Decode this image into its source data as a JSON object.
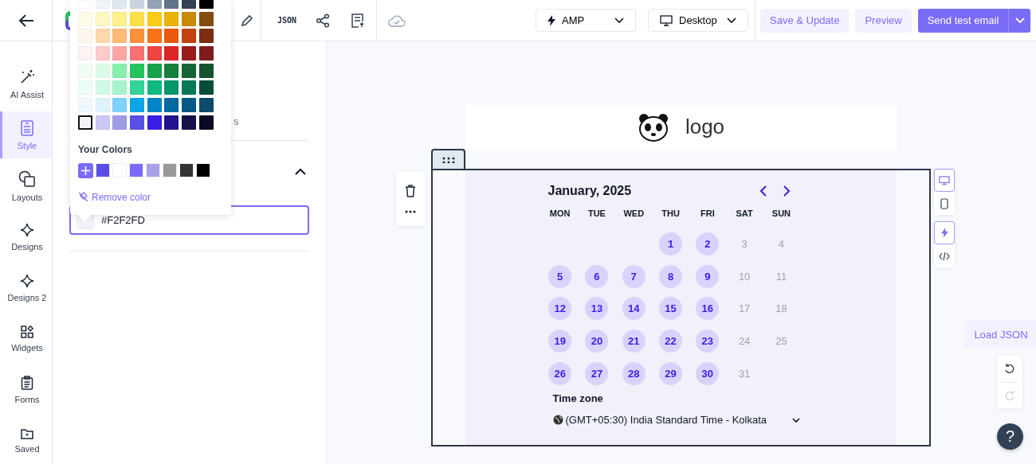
{
  "toolbar": {
    "json_label": "JSON",
    "amp_dropdown": "AMP",
    "device_dropdown": "Desktop",
    "save_button": "Save & Update",
    "preview_button": "Preview",
    "send_button": "Send test email"
  },
  "rail": [
    {
      "kind": "wand",
      "label": "AI Assist",
      "selected": false
    },
    {
      "kind": "style",
      "label": "Style",
      "selected": true
    },
    {
      "kind": "layouts",
      "label": "Layouts",
      "selected": false
    },
    {
      "kind": "sparkle",
      "label": "Designs",
      "selected": false
    },
    {
      "kind": "sparkle",
      "label": "Designs 2",
      "selected": false
    },
    {
      "kind": "widgets",
      "label": "Widgets",
      "selected": false
    },
    {
      "kind": "forms",
      "label": "Forms",
      "selected": false
    },
    {
      "kind": "saved",
      "label": "Saved",
      "selected": false
    }
  ],
  "panel": {
    "tab_fragment": "s",
    "expanded": true,
    "color_field": {
      "value": "#F2F2FD",
      "color": "#f2f2fd"
    }
  },
  "color_picker": {
    "palette": [
      [
        {
          "color": "#ffffff",
          "selected": false
        },
        {
          "color": "#f1f5f9",
          "selected": false
        },
        {
          "color": "#e2e8f0",
          "selected": false
        },
        {
          "color": "#cbd5e1",
          "selected": false
        },
        {
          "color": "#94a3b8",
          "selected": false
        },
        {
          "color": "#64748b",
          "selected": false
        },
        {
          "color": "#334155",
          "selected": false
        },
        {
          "color": "#000000",
          "selected": false
        }
      ],
      [
        {
          "color": "#fefce8",
          "selected": false
        },
        {
          "color": "#fef9c3",
          "selected": false
        },
        {
          "color": "#fef08a",
          "selected": false
        },
        {
          "color": "#fde047",
          "selected": false
        },
        {
          "color": "#facc15",
          "selected": false
        },
        {
          "color": "#eab308",
          "selected": false
        },
        {
          "color": "#ca8a04",
          "selected": false
        },
        {
          "color": "#854d0e",
          "selected": false
        }
      ],
      [
        {
          "color": "#fff7ed",
          "selected": false
        },
        {
          "color": "#fed7aa",
          "selected": false
        },
        {
          "color": "#fdba74",
          "selected": false
        },
        {
          "color": "#fb923c",
          "selected": false
        },
        {
          "color": "#f97316",
          "selected": false
        },
        {
          "color": "#ea580c",
          "selected": false
        },
        {
          "color": "#c2410c",
          "selected": false
        },
        {
          "color": "#7c2d12",
          "selected": false
        }
      ],
      [
        {
          "color": "#fef2f2",
          "selected": false
        },
        {
          "color": "#fecaca",
          "selected": false
        },
        {
          "color": "#fca5a5",
          "selected": false
        },
        {
          "color": "#f87171",
          "selected": false
        },
        {
          "color": "#ef4444",
          "selected": false
        },
        {
          "color": "#dc2626",
          "selected": false
        },
        {
          "color": "#991b1b",
          "selected": false
        },
        {
          "color": "#7f1d1d",
          "selected": false
        }
      ],
      [
        {
          "color": "#f0fdf4",
          "selected": false
        },
        {
          "color": "#dcfce7",
          "selected": false
        },
        {
          "color": "#86efac",
          "selected": false
        },
        {
          "color": "#22c55e",
          "selected": false
        },
        {
          "color": "#16a34a",
          "selected": false
        },
        {
          "color": "#15803d",
          "selected": false
        },
        {
          "color": "#166534",
          "selected": false
        },
        {
          "color": "#14532d",
          "selected": false
        }
      ],
      [
        {
          "color": "#ecfdf5",
          "selected": false
        },
        {
          "color": "#d1fae5",
          "selected": false
        },
        {
          "color": "#a7f3d0",
          "selected": false
        },
        {
          "color": "#34d399",
          "selected": false
        },
        {
          "color": "#10b981",
          "selected": false
        },
        {
          "color": "#059669",
          "selected": false
        },
        {
          "color": "#047857",
          "selected": false
        },
        {
          "color": "#064e3b",
          "selected": false
        }
      ],
      [
        {
          "color": "#f0f9ff",
          "selected": false
        },
        {
          "color": "#e0f2fe",
          "selected": false
        },
        {
          "color": "#7dd3fc",
          "selected": false
        },
        {
          "color": "#0ea5e9",
          "selected": false
        },
        {
          "color": "#0284c7",
          "selected": false
        },
        {
          "color": "#0369a1",
          "selected": false
        },
        {
          "color": "#075985",
          "selected": false
        },
        {
          "color": "#0c4a6e",
          "selected": false
        }
      ],
      [
        {
          "color": "#f2f2fd",
          "selected": true
        },
        {
          "color": "#cbc8f8",
          "selected": false
        },
        {
          "color": "#a09be8",
          "selected": false
        },
        {
          "color": "#5a50e6",
          "selected": false
        },
        {
          "color": "#3a1ee6",
          "selected": false
        },
        {
          "color": "#23148e",
          "selected": false
        },
        {
          "color": "#13104a",
          "selected": false
        },
        {
          "color": "#0b0a26",
          "selected": false
        }
      ]
    ],
    "your_colors_title": "Your Colors",
    "your_colors": [
      {
        "color": "#5b4ee5"
      },
      {
        "color": "#ffffff"
      },
      {
        "color": "#7a6cf6"
      },
      {
        "color": "#a7a1e8"
      },
      {
        "color": "#999999"
      },
      {
        "color": "#333333"
      },
      {
        "color": "#000000"
      }
    ],
    "remove_color": "Remove color"
  },
  "email": {
    "logo_text": "logo",
    "calendar": {
      "title": "January, 2025",
      "weekdays": [
        "MON",
        "TUE",
        "WED",
        "THU",
        "FRI",
        "SAT",
        "SUN"
      ],
      "weeks": [
        [
          {
            "label": "1",
            "available": true
          },
          {
            "label": "2",
            "available": true
          },
          {
            "label": "3",
            "available": false
          },
          {
            "label": "4",
            "available": false
          }
        ],
        [
          {
            "label": "5",
            "available": true
          },
          {
            "label": "6",
            "available": true
          },
          {
            "label": "7",
            "available": true
          },
          {
            "label": "8",
            "available": true
          },
          {
            "label": "9",
            "available": true
          },
          {
            "label": "10",
            "available": false
          },
          {
            "label": "11",
            "available": false
          }
        ],
        [
          {
            "label": "12",
            "available": true
          },
          {
            "label": "13",
            "available": true
          },
          {
            "label": "14",
            "available": true
          },
          {
            "label": "15",
            "available": true
          },
          {
            "label": "16",
            "available": true
          },
          {
            "label": "17",
            "available": false
          },
          {
            "label": "18",
            "available": false
          }
        ],
        [
          {
            "label": "19",
            "available": true
          },
          {
            "label": "20",
            "available": true
          },
          {
            "label": "21",
            "available": true
          },
          {
            "label": "22",
            "available": true
          },
          {
            "label": "23",
            "available": true
          },
          {
            "label": "24",
            "available": false
          },
          {
            "label": "25",
            "available": false
          }
        ],
        [
          {
            "label": "26",
            "available": true
          },
          {
            "label": "27",
            "available": true
          },
          {
            "label": "28",
            "available": true
          },
          {
            "label": "29",
            "available": true
          },
          {
            "label": "30",
            "available": true
          },
          {
            "label": "31",
            "available": false
          }
        ]
      ],
      "timezone_label": "Time zone",
      "timezone_value": "(GMT+05:30) India Standard Time - Kolkata"
    }
  },
  "side_tools": [
    {
      "kind": "desktop",
      "selected": true
    },
    {
      "kind": "mobile",
      "selected": false
    },
    {
      "kind": "amp",
      "selected": true
    },
    {
      "kind": "html",
      "selected": false
    }
  ],
  "load_json": "Load JSON",
  "help": "?"
}
